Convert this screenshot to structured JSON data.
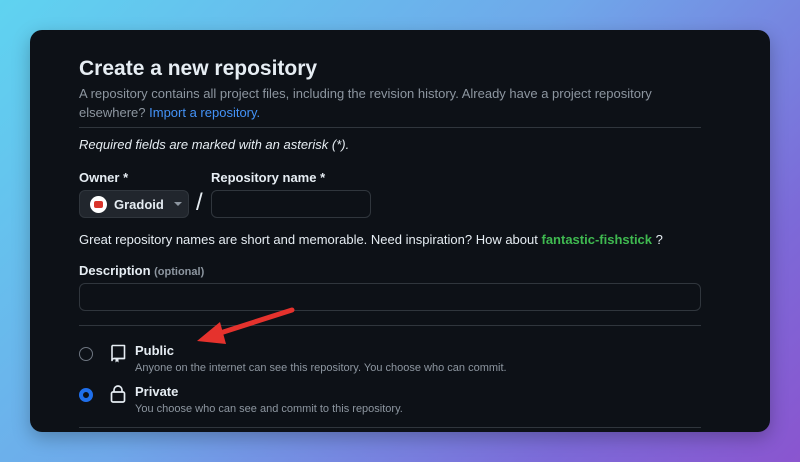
{
  "page": {
    "title": "Create a new repository",
    "subtitle": "A repository contains all project files, including the revision history. Already have a project repository elsewhere?",
    "import_link": "Import a repository.",
    "required_note": "Required fields are marked with an asterisk (*)."
  },
  "owner": {
    "label": "Owner *",
    "value": "Gradoid",
    "avatar": "gradoid-avatar"
  },
  "separator": "/",
  "repo_name": {
    "label": "Repository name *",
    "value": "",
    "placeholder": ""
  },
  "hint": {
    "text": "Great repository names are short and memorable. Need inspiration? How about",
    "suggestion": "fantastic-fishstick",
    "suffix": "?"
  },
  "description": {
    "label": "Description",
    "optional": "(optional)",
    "value": ""
  },
  "visibility": {
    "options": [
      {
        "label": "Public",
        "description": "Anyone on the internet can see this repository. You choose who can commit.",
        "icon": "repo-icon",
        "selected": false
      },
      {
        "label": "Private",
        "description": "You choose who can see and commit to this repository.",
        "icon": "lock-icon",
        "selected": true
      }
    ]
  },
  "annotation": {
    "arrow_color": "#e5322d"
  },
  "colors": {
    "background": "#0d1117",
    "accent": "#1f6feb",
    "link": "#4493f8",
    "suggestion": "#3fb950"
  }
}
